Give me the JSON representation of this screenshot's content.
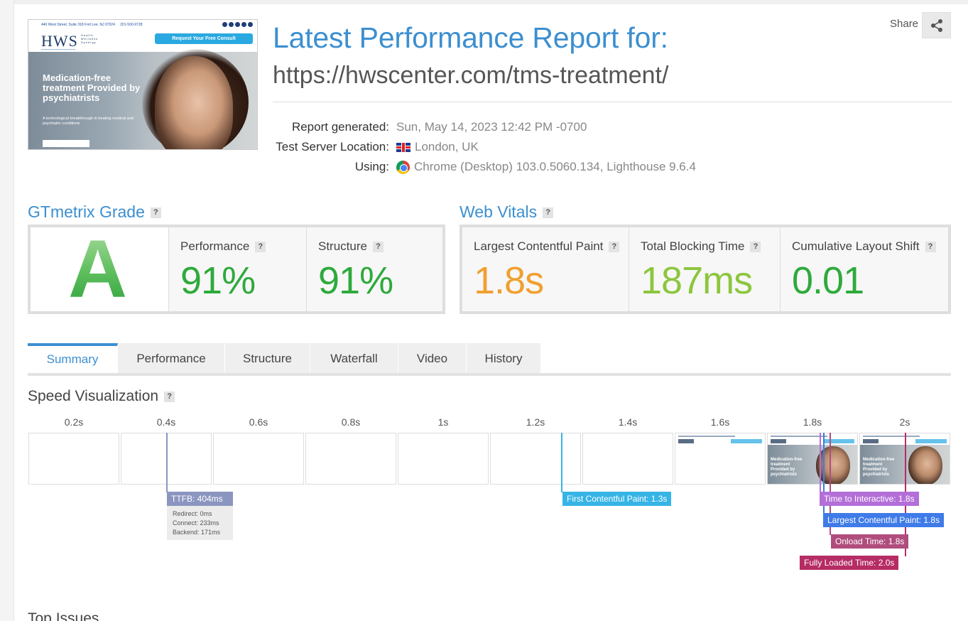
{
  "header": {
    "title": "Latest Performance Report for:",
    "url": "https://hwscenter.com/tms-treatment/",
    "share_label": "Share",
    "meta": [
      {
        "label": "Report generated:",
        "value": "Sun, May 14, 2023 12:42 PM -0700",
        "icon": ""
      },
      {
        "label": "Test Server Location:",
        "value": "London, UK",
        "icon": "uk-flag-icon"
      },
      {
        "label": "Using:",
        "value": "Chrome (Desktop) 103.0.5060.134, Lighthouse 9.6.4",
        "icon": "chrome-icon"
      }
    ]
  },
  "thumbnail": {
    "address": "440 West Street, Suite 318 Fort Lee, NJ 07024",
    "phone": "201-500-9728",
    "logo": "HWS",
    "logo_tagline": "Health Wellness Synergy",
    "cta": "Request Your Free Consult",
    "headline": "Medication-free treatment Provided by psychiatrists",
    "subline": "A technological breakthrough in treating medical and psychiatric conditions"
  },
  "grade": {
    "title": "GTmetrix Grade",
    "letter": "A",
    "performance_label": "Performance",
    "performance_value": "91%",
    "structure_label": "Structure",
    "structure_value": "91%"
  },
  "vitals": {
    "title": "Web Vitals",
    "lcp_label": "Largest Contentful Paint",
    "lcp_value": "1.8s",
    "tbt_label": "Total Blocking Time",
    "tbt_value": "187ms",
    "cls_label": "Cumulative Layout Shift",
    "cls_value": "0.01"
  },
  "colors": {
    "accent": "#3c8fd0",
    "green": "#2eaa3c",
    "orange": "#f0a030",
    "lightgreen": "#8cc63e",
    "ttfb": "#8b95c0",
    "fcp": "#36b4e6",
    "tti": "#b36ed8",
    "lcp": "#3f7be8",
    "onload": "#b04d7e",
    "fully_loaded": "#b62c65"
  },
  "tabs": [
    "Summary",
    "Performance",
    "Structure",
    "Waterfall",
    "Video",
    "History"
  ],
  "speed_viz": {
    "title": "Speed Visualization",
    "ticks": [
      "0.2s",
      "0.4s",
      "0.6s",
      "0.8s",
      "1s",
      "1.2s",
      "1.4s",
      "1.6s",
      "1.8s",
      "2s"
    ],
    "ttfb_label": "TTFB: 404ms",
    "ttfb_redirect": "Redirect: 0ms",
    "ttfb_connect": "Connect: 233ms",
    "ttfb_backend": "Backend: 171ms",
    "fcp_label": "First Contentful Paint: 1.3s",
    "tti_label": "Time to Interactive: 1.8s",
    "lcp_label": "Largest Contentful Paint: 1.8s",
    "onload_label": "Onload Time: 1.8s",
    "fully_loaded_label": "Fully Loaded Time: 2.0s"
  },
  "top_issues_title": "Top Issues"
}
